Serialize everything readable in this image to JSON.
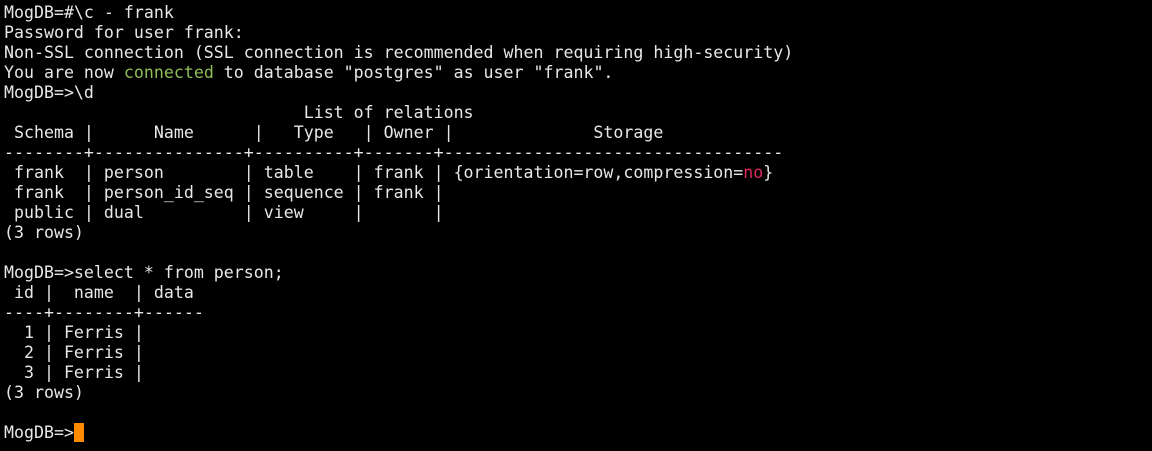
{
  "colors": {
    "background": "#000000",
    "text": "#e8e8e8",
    "highlight_green": "#8fbf56",
    "highlight_red": "#e0285e",
    "cursor": "#ff8c00"
  },
  "terminal": {
    "lines": [
      {
        "segments": [
          {
            "text": "MogDB=#\\c - frank"
          }
        ]
      },
      {
        "segments": [
          {
            "text": "Password for user frank:"
          }
        ]
      },
      {
        "segments": [
          {
            "text": "Non-SSL connection (SSL connection is recommended when requiring high-security)"
          }
        ]
      },
      {
        "segments": [
          {
            "text": "You are now "
          },
          {
            "text": "connected",
            "color": "green"
          },
          {
            "text": " to database \"postgres\" as user \"frank\"."
          }
        ]
      },
      {
        "segments": [
          {
            "text": "MogDB=>\\d"
          }
        ]
      },
      {
        "segments": [
          {
            "text": "                              List of relations"
          }
        ]
      },
      {
        "segments": [
          {
            "text": " Schema |      Name      |   Type   | Owner |              Storage"
          }
        ]
      },
      {
        "segments": [
          {
            "text": "--------+---------------+----------+-------+----------------------------------"
          }
        ]
      },
      {
        "segments": [
          {
            "text": " frank  | person        | table    | frank | {orientation=row,compression="
          },
          {
            "text": "no",
            "color": "red"
          },
          {
            "text": "}"
          }
        ]
      },
      {
        "segments": [
          {
            "text": " frank  | person_id_seq | sequence | frank |"
          }
        ]
      },
      {
        "segments": [
          {
            "text": " public | dual          | view     |       |"
          }
        ]
      },
      {
        "segments": [
          {
            "text": "(3 rows)"
          }
        ]
      },
      {
        "segments": [
          {
            "text": ""
          }
        ]
      },
      {
        "segments": [
          {
            "text": "MogDB=>select * from person;"
          }
        ]
      },
      {
        "segments": [
          {
            "text": " id |  name  | data"
          }
        ]
      },
      {
        "segments": [
          {
            "text": "----+--------+------"
          }
        ]
      },
      {
        "segments": [
          {
            "text": "  1 | Ferris |"
          }
        ]
      },
      {
        "segments": [
          {
            "text": "  2 | Ferris |"
          }
        ]
      },
      {
        "segments": [
          {
            "text": "  3 | Ferris |"
          }
        ]
      },
      {
        "segments": [
          {
            "text": "(3 rows)"
          }
        ]
      },
      {
        "segments": [
          {
            "text": ""
          }
        ]
      },
      {
        "segments": [
          {
            "text": "MogDB=>"
          }
        ],
        "cursor": true
      }
    ]
  }
}
